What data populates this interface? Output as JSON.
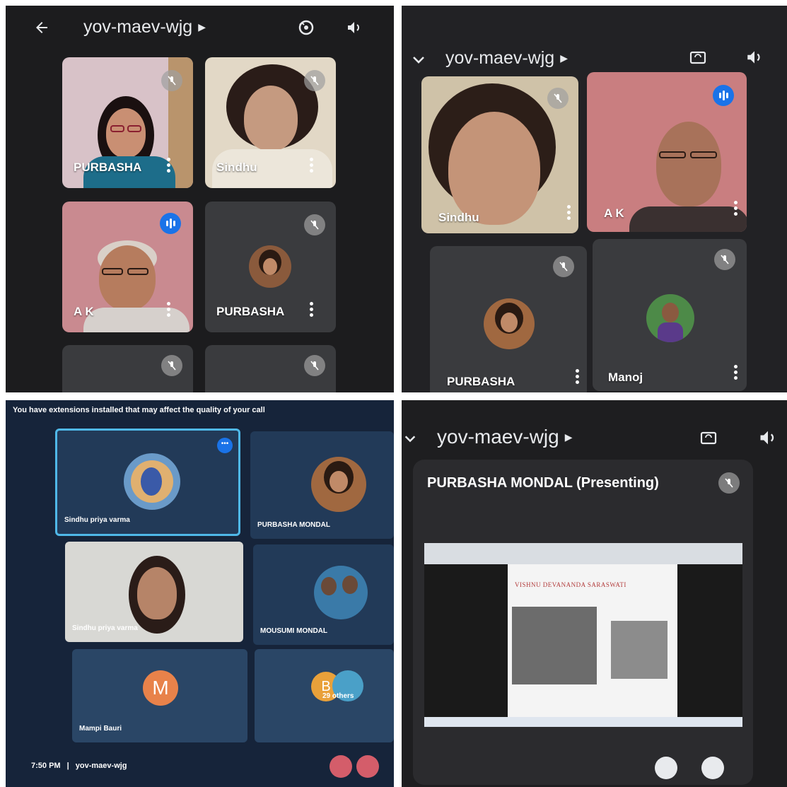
{
  "panel1": {
    "meeting_code": "yov-maev-wjg",
    "tiles": [
      {
        "name": "PURBASHA"
      },
      {
        "name": "Sindhu"
      },
      {
        "name": "A K"
      },
      {
        "name": "PURBASHA"
      }
    ]
  },
  "panel2": {
    "meeting_code": "yov-maev-wjg",
    "tiles": [
      {
        "name": "Sindhu"
      },
      {
        "name": "A K"
      },
      {
        "name": "PURBASHA"
      },
      {
        "name": "Manoj"
      }
    ]
  },
  "panel3": {
    "warning": "You have extensions installed that may affect the quality of your call",
    "tiles": [
      {
        "name": "Sindhu priya varma"
      },
      {
        "name": "PURBASHA MONDAL"
      },
      {
        "name": "Sindhu priya varma"
      },
      {
        "name": "MOUSUMI MONDAL"
      },
      {
        "name": "Mampi Bauri",
        "initial": "M"
      },
      {
        "name": "29 others",
        "initial": "B"
      }
    ],
    "time": "7:50 PM",
    "separator": "|",
    "meeting_code": "yov-maev-wjg"
  },
  "panel4": {
    "meeting_code": "yov-maev-wjg",
    "presenter_label": "PURBASHA MONDAL (Presenting)",
    "slide_title": "VISHNU DEVANANDA SARASWATI"
  },
  "colors": {
    "speaking_blue": "#1a73e8",
    "tile_bg": "#3c4043",
    "meet_dark": "#1c1c1e"
  }
}
